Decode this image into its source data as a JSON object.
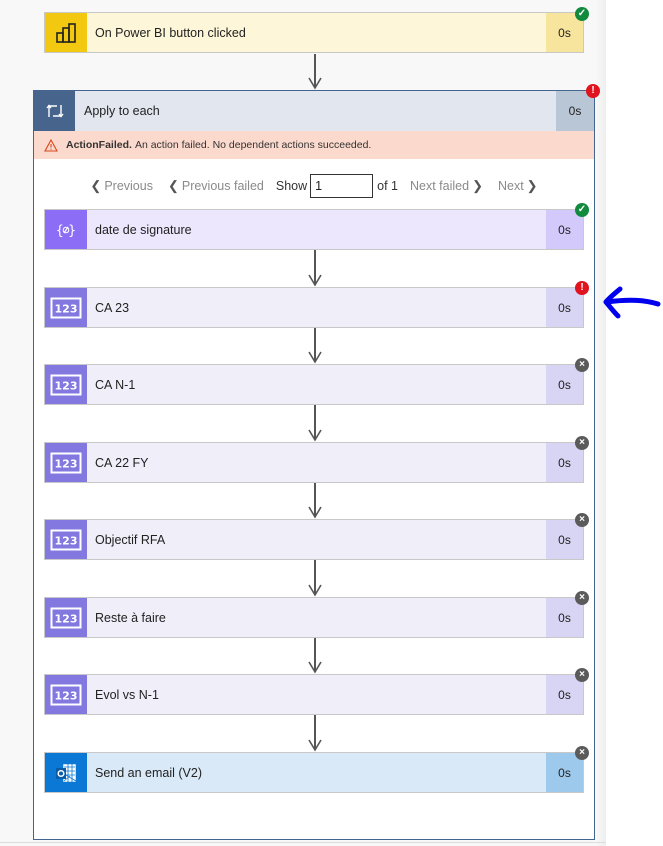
{
  "trigger": {
    "title": "On Power BI button clicked",
    "duration": "0s",
    "status": "succeeded",
    "icon": "power-bi-icon"
  },
  "loop": {
    "title": "Apply to each",
    "duration": "0s",
    "status": "failed",
    "icon": "loop-icon",
    "error": {
      "code": "ActionFailed.",
      "message": "An action failed. No dependent actions succeeded."
    },
    "pager": {
      "previous": "Previous",
      "previous_failed": "Previous failed",
      "show_label": "Show",
      "current": "1",
      "of_label": "of 1",
      "next_failed": "Next failed",
      "next": "Next"
    },
    "actions": [
      {
        "title": "date de signature",
        "duration": "0s",
        "status": "succeeded",
        "icon": "compose-variable-icon",
        "kind": "compose"
      },
      {
        "title": "CA 23",
        "duration": "0s",
        "status": "failed",
        "icon": "integer-variable-icon",
        "kind": "variable"
      },
      {
        "title": "CA N-1",
        "duration": "0s",
        "status": "skipped",
        "icon": "integer-variable-icon",
        "kind": "variable"
      },
      {
        "title": "CA 22 FY",
        "duration": "0s",
        "status": "skipped",
        "icon": "integer-variable-icon",
        "kind": "variable"
      },
      {
        "title": "Objectif RFA",
        "duration": "0s",
        "status": "skipped",
        "icon": "integer-variable-icon",
        "kind": "variable"
      },
      {
        "title": "Reste à faire",
        "duration": "0s",
        "status": "skipped",
        "icon": "integer-variable-icon",
        "kind": "variable"
      },
      {
        "title": "Evol vs N-1",
        "duration": "0s",
        "status": "skipped",
        "icon": "integer-variable-icon",
        "kind": "variable"
      },
      {
        "title": "Send an email (V2)",
        "duration": "0s",
        "status": "skipped",
        "icon": "outlook-icon",
        "kind": "email"
      }
    ]
  },
  "badges": {
    "succeeded": "✓",
    "failed": "!",
    "skipped": "×"
  },
  "integer_icon_text": "123",
  "colors": {
    "annotation_arrow": "#0000ee",
    "loop_border": "#44658f",
    "error_bar": "#fcd9cd"
  }
}
